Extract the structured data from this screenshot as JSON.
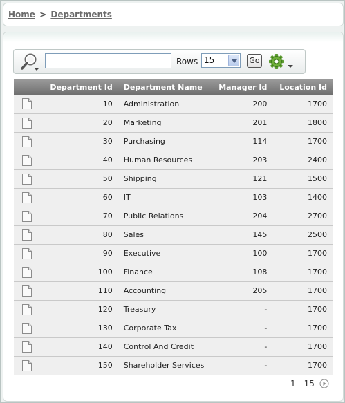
{
  "breadcrumb": {
    "home": "Home",
    "separator": ">",
    "current": "Departments"
  },
  "search": {
    "value": "",
    "rows_label": "Rows",
    "rows_selected": "15",
    "go_label": "Go"
  },
  "icons": {
    "search": "magnifier-icon",
    "actions": "gear-icon",
    "row": "document-icon",
    "next": "next-arrow-icon"
  },
  "table": {
    "columns": [
      "Department Id",
      "Department Name",
      "Manager Id",
      "Location Id"
    ],
    "rows": [
      [
        "10",
        "Administration",
        "200",
        "1700"
      ],
      [
        "20",
        "Marketing",
        "201",
        "1800"
      ],
      [
        "30",
        "Purchasing",
        "114",
        "1700"
      ],
      [
        "40",
        "Human Resources",
        "203",
        "2400"
      ],
      [
        "50",
        "Shipping",
        "121",
        "1500"
      ],
      [
        "60",
        "IT",
        "103",
        "1400"
      ],
      [
        "70",
        "Public Relations",
        "204",
        "2700"
      ],
      [
        "80",
        "Sales",
        "145",
        "2500"
      ],
      [
        "90",
        "Executive",
        "100",
        "1700"
      ],
      [
        "100",
        "Finance",
        "108",
        "1700"
      ],
      [
        "110",
        "Accounting",
        "205",
        "1700"
      ],
      [
        "120",
        "Treasury",
        "-",
        "1700"
      ],
      [
        "130",
        "Corporate Tax",
        "-",
        "1700"
      ],
      [
        "140",
        "Control And Credit",
        "-",
        "1700"
      ],
      [
        "150",
        "Shareholder Services",
        "-",
        "1700"
      ]
    ]
  },
  "pagination": {
    "range": "1 - 15"
  }
}
